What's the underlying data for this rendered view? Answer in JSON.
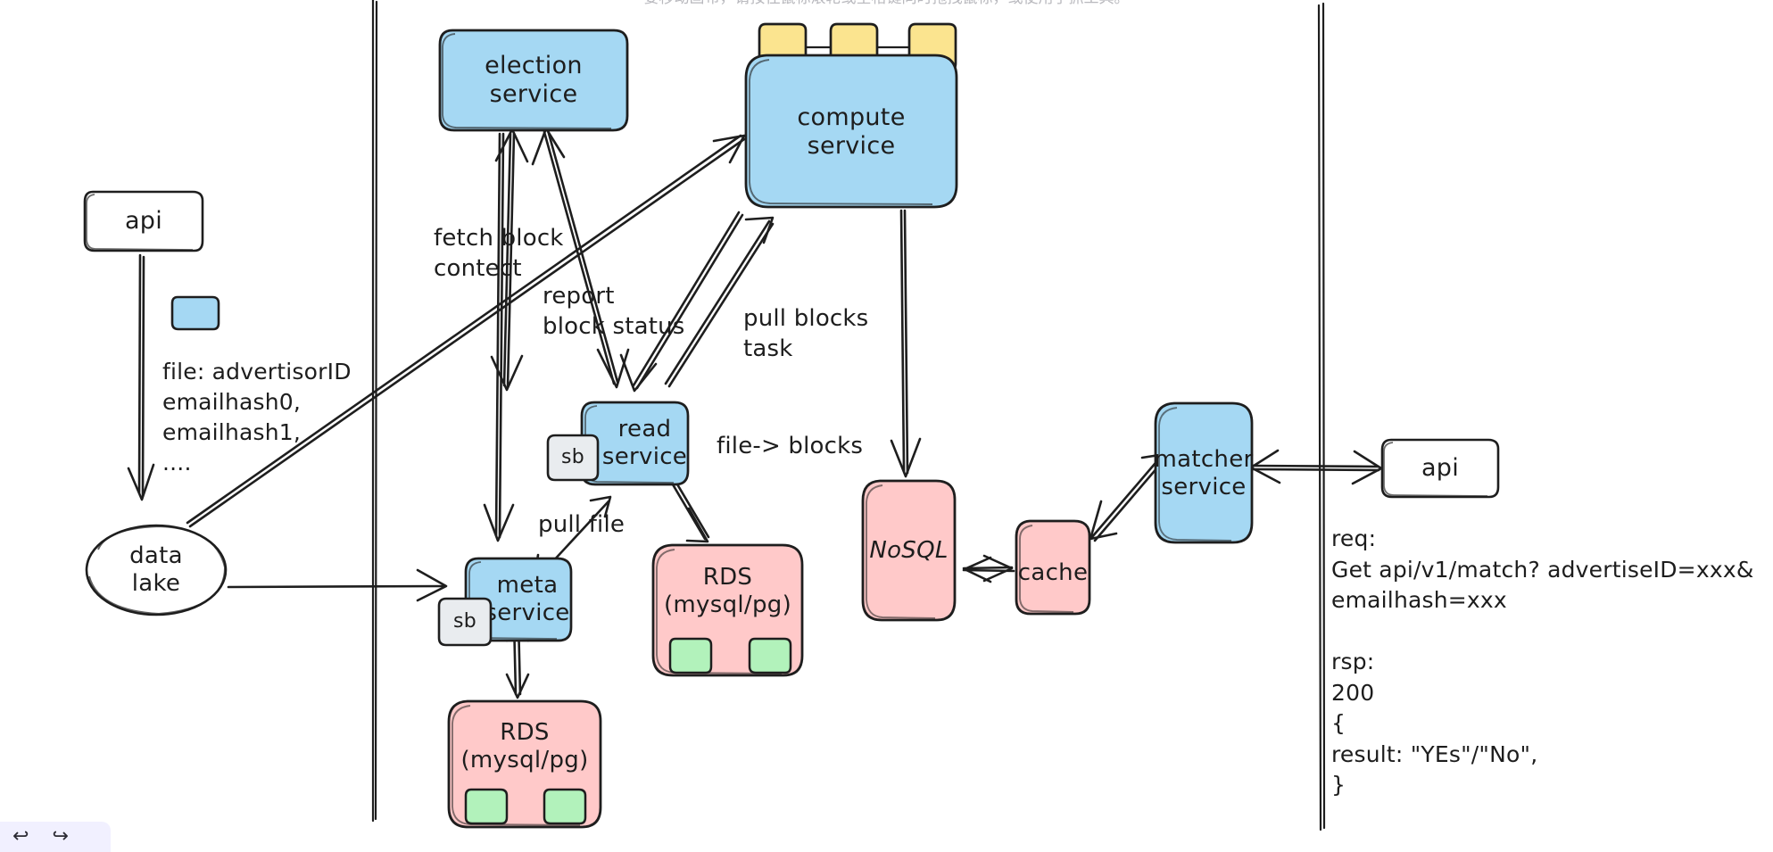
{
  "top_hint": "要移动画布，请按住鼠标滚轮或空格键同时拖拽鼠标，或使用手抓工具。",
  "colors": {
    "service_blue": "#a5d8f3",
    "datastore_pink": "#ffc9c9",
    "worker_yellow": "#fbe48f",
    "shard_green": "#b2f2bb",
    "sb_grey": "#e9ecef",
    "stroke": "#1e1e1e",
    "white": "#ffffff"
  },
  "nodes": {
    "api_left": {
      "label": "api",
      "shape": "rounded-rect",
      "fill": "white"
    },
    "legend_swatch": {
      "label": "",
      "shape": "small-rounded-rect",
      "fill": "service_blue"
    },
    "data_lake": {
      "label": "data\nlake",
      "shape": "ellipse",
      "fill": "white"
    },
    "election_service": {
      "label": "election\nservice",
      "shape": "rounded-rect",
      "fill": "service_blue"
    },
    "compute_service": {
      "label": "compute\nservice",
      "shape": "rounded-rect",
      "fill": "service_blue"
    },
    "compute_workers": [
      {
        "label": "",
        "fill": "worker_yellow"
      },
      {
        "label": "",
        "fill": "worker_yellow"
      },
      {
        "label": "",
        "fill": "worker_yellow"
      }
    ],
    "read_service": {
      "label": "read\nservice",
      "shape": "rounded-rect",
      "fill": "service_blue"
    },
    "read_service_sb": {
      "label": "sb",
      "shape": "rounded-rect",
      "fill": "sb_grey"
    },
    "meta_service": {
      "label": "meta\nservice",
      "shape": "rounded-rect",
      "fill": "service_blue"
    },
    "meta_service_sb": {
      "label": "sb",
      "shape": "rounded-rect",
      "fill": "sb_grey"
    },
    "rds_read": {
      "label": "RDS\n(mysql/pg)",
      "shape": "rounded-rect",
      "fill": "datastore_pink"
    },
    "rds_meta": {
      "label": "RDS\n(mysql/pg)",
      "shape": "rounded-rect",
      "fill": "datastore_pink"
    },
    "rds_read_shards": [
      {
        "label": ""
      },
      {
        "label": ""
      }
    ],
    "rds_meta_shards": [
      {
        "label": ""
      },
      {
        "label": ""
      }
    ],
    "nosql": {
      "label": "NoSQL",
      "shape": "rounded-rect",
      "fill": "datastore_pink"
    },
    "cache": {
      "label": "cache",
      "shape": "rounded-rect",
      "fill": "datastore_pink"
    },
    "matcher_service": {
      "label": "matcher\nservice",
      "shape": "rounded-rect",
      "fill": "service_blue"
    },
    "api_right": {
      "label": "api",
      "shape": "rounded-rect",
      "fill": "white"
    }
  },
  "edge_labels": {
    "fetch_block_contect": "fetch block\ncontect",
    "report_block_status": "report\nblock status",
    "pull_blocks_task": "pull  blocks\ntask",
    "file_to_blocks": "file-> blocks",
    "pull_file": "pull file"
  },
  "annotations": {
    "file_schema": "file: advertisorID\nemailhash0,\nemailhash1,\n....",
    "api_contract": "req:\nGet api/v1/match? advertiseID=xxx&\nemailhash=xxx\n\nrsp:\n200\n{\n   result: \"YEs\"/\"No\",\n}"
  },
  "toolbar": {
    "undo_icon": "↩",
    "redo_icon": "↪"
  }
}
